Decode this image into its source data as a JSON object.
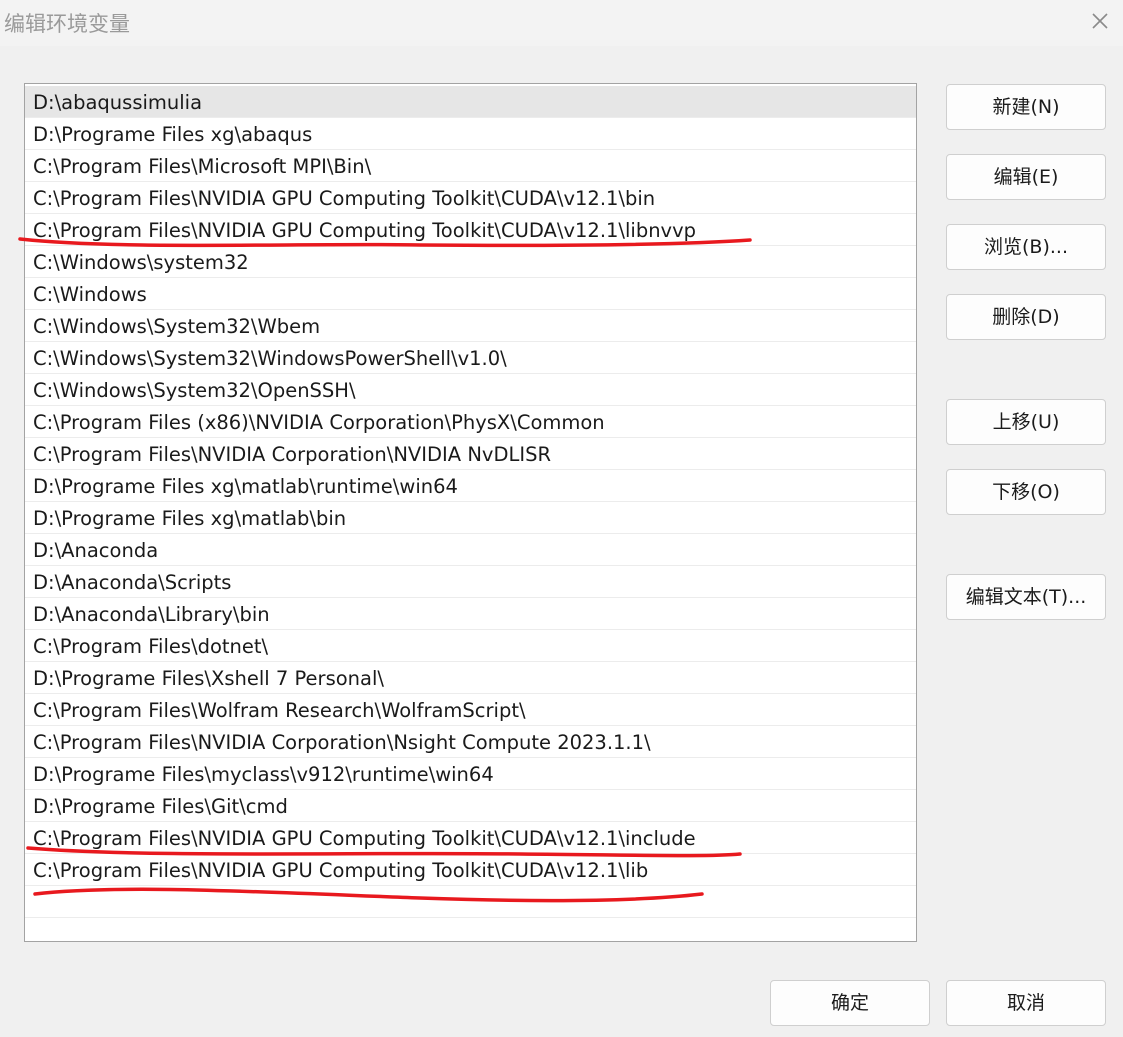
{
  "dialog": {
    "title": "编辑环境变量"
  },
  "paths": [
    "D:\\abaqussimulia",
    "D:\\Programe Files xg\\abaqus",
    "C:\\Program Files\\Microsoft MPI\\Bin\\",
    "C:\\Program Files\\NVIDIA GPU Computing Toolkit\\CUDA\\v12.1\\bin",
    "C:\\Program Files\\NVIDIA GPU Computing Toolkit\\CUDA\\v12.1\\libnvvp",
    "C:\\Windows\\system32",
    "C:\\Windows",
    "C:\\Windows\\System32\\Wbem",
    "C:\\Windows\\System32\\WindowsPowerShell\\v1.0\\",
    "C:\\Windows\\System32\\OpenSSH\\",
    "C:\\Program Files (x86)\\NVIDIA Corporation\\PhysX\\Common",
    "C:\\Program Files\\NVIDIA Corporation\\NVIDIA NvDLISR",
    "D:\\Programe Files xg\\matlab\\runtime\\win64",
    "D:\\Programe Files xg\\matlab\\bin",
    "D:\\Anaconda",
    "D:\\Anaconda\\Scripts",
    "D:\\Anaconda\\Library\\bin",
    "C:\\Program Files\\dotnet\\",
    "D:\\Programe Files\\Xshell 7 Personal\\",
    "C:\\Program Files\\Wolfram Research\\WolframScript\\",
    "C:\\Program Files\\NVIDIA Corporation\\Nsight Compute 2023.1.1\\",
    "D:\\Programe Files\\myclass\\v912\\runtime\\win64",
    "D:\\Programe Files\\Git\\cmd",
    "C:\\Program Files\\NVIDIA GPU Computing Toolkit\\CUDA\\v12.1\\include",
    "C:\\Program Files\\NVIDIA GPU Computing Toolkit\\CUDA\\v12.1\\lib",
    ""
  ],
  "selected_index": 0,
  "annotation_color": "#e8191e",
  "buttons": {
    "new": "新建(N)",
    "edit": "编辑(E)",
    "browse": "浏览(B)...",
    "delete": "删除(D)",
    "move_up": "上移(U)",
    "move_down": "下移(O)",
    "edit_text": "编辑文本(T)...",
    "ok": "确定",
    "cancel": "取消"
  }
}
